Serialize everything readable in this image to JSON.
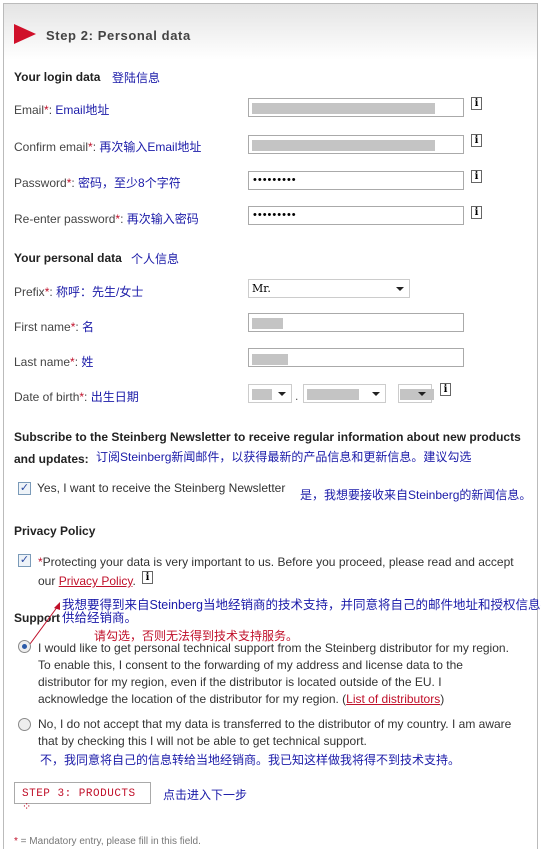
{
  "header": {
    "title": "Step 2: Personal data"
  },
  "login": {
    "heading": "Your login data",
    "heading_cn": "登陆信息",
    "email": {
      "label": "Email",
      "cn": "Email地址"
    },
    "confirm": {
      "label": "Confirm email",
      "cn": "再次输入Email地址"
    },
    "password": {
      "label": "Password",
      "cn": "密码，至少8个字符",
      "value": "•••••••••"
    },
    "reenter": {
      "label": "Re-enter password",
      "cn": "再次输入密码",
      "value": "•••••••••"
    }
  },
  "personal": {
    "heading": "Your personal data",
    "heading_cn": "个人信息",
    "prefix": {
      "label": "Prefix",
      "cn": "称呼：先生/女士",
      "value": "Mr."
    },
    "first": {
      "label": "First name",
      "cn": "名"
    },
    "last": {
      "label": "Last name",
      "cn": "姓"
    },
    "dob": {
      "label": "Date of birth",
      "cn": "出生日期"
    }
  },
  "newsletter": {
    "heading1": "Subscribe to the Steinberg Newsletter to receive regular information about new products",
    "heading2": "and updates:",
    "heading_cn": "订阅Steinberg新闻邮件，以获得最新的产品信息和更新信息。建议勾选",
    "checkbox_label": "Yes, I want to receive the Steinberg Newsletter",
    "checkbox_cn": "是，我想要接收来自Steinberg的新闻信息。",
    "checked": true
  },
  "privacy": {
    "heading": "Privacy Policy",
    "line1": "Protecting your data is very important to us. Before you proceed, please read and accept",
    "line2_prefix": "our ",
    "link": "Privacy Policy",
    "line2_suffix": ".",
    "checked": true
  },
  "annotation": {
    "cn1": "我想要得到来自Steinberg当地经销商的技术支持，并同意将自己的邮件地址和授权信息提",
    "cn2": "供给经销商。",
    "red": "请勾选，否则无法得到技术支持服务。"
  },
  "support": {
    "heading": "Support",
    "yes_lines": [
      "I would like to get personal technical support from the Steinberg distributor for my region.",
      "To enable this, I consent to the forwarding of my address and license data to the",
      "distributor for my region, even if the distributor is located outside of the EU. I",
      "acknowledge the location of the distributor for my region.  ("
    ],
    "yes_link": "List of distributors",
    "yes_close": ")",
    "no_lines": [
      "No, I do not accept that my data is transferred to the distributor of my country. I am aware",
      "that by checking this I will not be able to get technical support."
    ],
    "no_cn": "不，我同意将自己的信息转给当地经销商。我已知这样做我将得不到技术支持。",
    "selected": "yes"
  },
  "button": {
    "label": "STEP 3: PRODUCTS",
    "cn": "点击进入下一步"
  },
  "footer": {
    "star": "*",
    "text": " = Mandatory entry, please fill in this field."
  },
  "required_mark": "*",
  "colors": {
    "accent": "#d0102a",
    "annotation": "#1a1aa8"
  }
}
